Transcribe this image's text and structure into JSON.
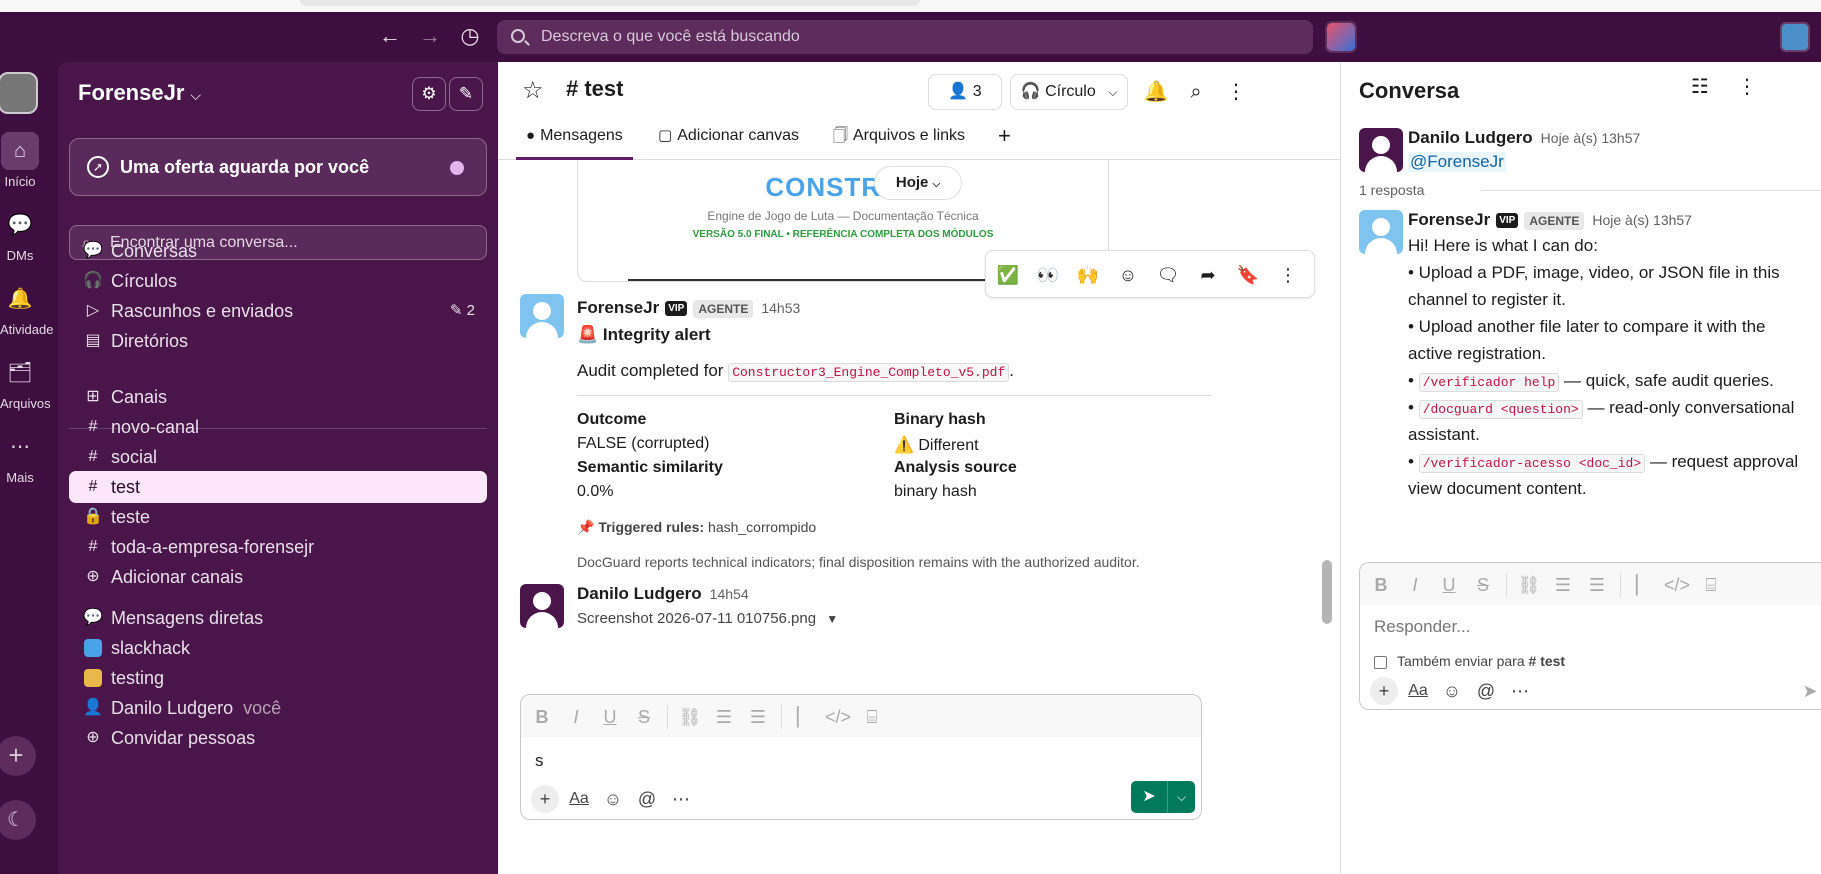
{
  "topbar": {
    "back_icon": "←",
    "forward_icon": "→",
    "history_icon": "◷",
    "search_placeholder": "Descreva o que você está buscando"
  },
  "rail": {
    "items": [
      {
        "label": "Início",
        "icon": "⌂"
      },
      {
        "label": "DMs",
        "icon": "💬"
      },
      {
        "label": "Atividade",
        "icon": "🔔"
      },
      {
        "label": "Arquivos",
        "icon": "🗂"
      },
      {
        "label": "Mais",
        "icon": "⋯"
      }
    ]
  },
  "sidebar": {
    "workspace": "ForenseJr",
    "offer": "Uma oferta aguarda por você",
    "find_placeholder": "Encontrar uma conversa...",
    "nav": [
      {
        "label": "Conversas",
        "icon": "💬"
      },
      {
        "label": "Círculos",
        "icon": "🎧"
      },
      {
        "label": "Rascunhos e enviados",
        "icon": "▷",
        "count": "2"
      },
      {
        "label": "Diretórios",
        "icon": "▤"
      }
    ],
    "channels_header": "Canais",
    "channels": [
      {
        "label": "novo-canal",
        "prefix": "#"
      },
      {
        "label": "social",
        "prefix": "#"
      },
      {
        "label": "test",
        "prefix": "#",
        "selected": true
      },
      {
        "label": "teste",
        "prefix": "🔒"
      },
      {
        "label": "toda-a-empresa-forensejr",
        "prefix": "#"
      }
    ],
    "add_channels": "Adicionar canais",
    "dm_header": "Mensagens diretas",
    "dms": [
      {
        "label": "slackhack",
        "color": "#4aa3e8"
      },
      {
        "label": "testing",
        "color": "#e8b84a"
      },
      {
        "label": "Danilo Ludgero",
        "color": "#888888",
        "you": "você"
      }
    ],
    "invite": "Convidar pessoas"
  },
  "channel": {
    "name": "test",
    "member_count": "3",
    "huddle_label": "Círculo",
    "tabs": [
      {
        "label": "Mensagens",
        "icon": "●"
      },
      {
        "label": "Adicionar canvas",
        "icon": "▢"
      },
      {
        "label": "Arquivos e links",
        "icon": "🗍"
      }
    ]
  },
  "preview": {
    "title": "CONSTRUC",
    "subtitle": "Engine de Jogo de Luta — Documentação Técnica",
    "version": "VERSÃO 5.0 FINAL • REFERÊNCIA COMPLETA DOS MÓDULOS"
  },
  "date_pill": "Hoje",
  "hover_reactions": [
    "✅",
    "👀",
    "🙌",
    "☺",
    "🗨",
    "➦",
    "🔖",
    "⋮"
  ],
  "messages": [
    {
      "author": "ForenseJr",
      "vip": "VIP",
      "tag": "AGENTE",
      "time": "14h53",
      "alert_title": "🚨 Integrity alert",
      "audit_prefix": "Audit completed for ",
      "file": "Constructor3_Engine_Completo_v5.pdf",
      "fields": [
        {
          "label": "Outcome",
          "value": "FALSE (corrupted)"
        },
        {
          "label": "Binary hash",
          "value": "⚠️ Different"
        },
        {
          "label": "Semantic similarity",
          "value": "0.0%"
        },
        {
          "label": "Analysis source",
          "value": "binary hash"
        }
      ],
      "rules_label": "📌 Triggered rules:",
      "rules_value": "hash_corrompido",
      "disclaimer": "DocGuard reports technical indicators; final disposition remains with the authorized auditor."
    },
    {
      "author": "Danilo Ludgero",
      "time": "14h54",
      "attachment": "Screenshot 2026-07-11 010756.png"
    }
  ],
  "composer": {
    "text": "s"
  },
  "thread": {
    "title": "Conversa",
    "parent_author": "Danilo Ludgero",
    "parent_time": "Hoje à(s) 13h57",
    "parent_text": "@ForenseJr",
    "reply_count": "1 resposta",
    "reply_author": "ForenseJr",
    "reply_vip": "VIP",
    "reply_tag": "AGENTE",
    "reply_time": "Hoje à(s) 13h57",
    "reply_lines": [
      "Hi! Here is what I can do:",
      "• Upload a PDF, image, video, or JSON file in this",
      "channel to register it.",
      "• Upload another file later to compare it with the",
      "active registration."
    ],
    "cmd1": "/verificador help",
    "cmd1_desc": " — quick, safe audit queries.",
    "cmd2": "/docguard <question>",
    "cmd2_desc": " — read-only conversational",
    "cmd2_desc2": "assistant.",
    "cmd3": "/verificador-acesso <doc_id>",
    "cmd3_desc": " — request approval",
    "cmd3_desc2": "view document content.",
    "reply_placeholder": "Responder...",
    "also_send": "Também enviar para",
    "also_send_channel": "# test"
  },
  "colors": {
    "aubergine": "#3f0e40",
    "sidebar": "#4a154b",
    "selected": "#fbe6f9",
    "send": "#007a5a",
    "code_red": "#c01343"
  }
}
